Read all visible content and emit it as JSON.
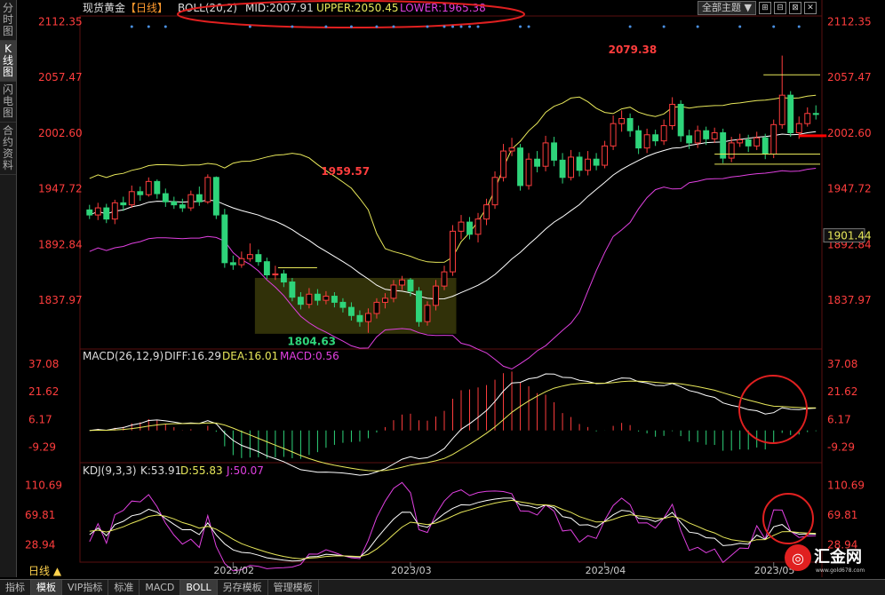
{
  "sidebar": {
    "items": [
      "分时图",
      "K线图",
      "闪电图",
      "合约资料"
    ],
    "active": 1
  },
  "top_controls": {
    "theme_select": "全部主题",
    "win_btns": [
      "⊞",
      "⊟",
      "⊠",
      "✕"
    ]
  },
  "bottom_bar": {
    "items": [
      "指标",
      "模板",
      "VIP指标",
      "标准",
      "MACD",
      "BOLL",
      "另存模板",
      "管理模板"
    ],
    "active": [
      1,
      5
    ]
  },
  "period_selector": "日线 ▲",
  "logo": {
    "text": "汇金网",
    "url": "www.gold678.com"
  },
  "colors": {
    "up": "#ff3d3d",
    "down": "#2ed47a",
    "up_fill": "#000000",
    "boll_mid": "#ffffff",
    "boll_upper": "#e8e85a",
    "boll_lower": "#e040e0",
    "diff": "#ffffff",
    "dea": "#e8e85a",
    "j": "#e040e0",
    "axis": "#ff3d3d"
  },
  "chart_data": [
    {
      "type": "candlestick",
      "title_parts": [
        "现货黄金",
        "【日线】"
      ],
      "indicator": {
        "name": "BOLL(20,2)",
        "mid_label": "MID:2007.91",
        "upper_label": "UPPER:2050.45",
        "lower_label": "LOWER:1965.38"
      },
      "yticks": [
        "2112.35",
        "2057.47",
        "2002.60",
        "1947.72",
        "1892.84",
        "1837.97"
      ],
      "ytick_values": [
        2112.35,
        2057.47,
        2002.6,
        1947.72,
        1892.84,
        1837.97
      ],
      "ylim": [
        1790,
        2118
      ],
      "current_price": "1901.44",
      "annotations": [
        {
          "text": "2079.38",
          "x": 61,
          "y": 2079.38
        },
        {
          "text": "1959.57",
          "x": 27,
          "y": 1959.57
        },
        {
          "text": "1804.63",
          "x": 23,
          "y": 1804.63
        }
      ],
      "candles": [
        [
          1927,
          1922,
          1932,
          1918
        ],
        [
          1922,
          1929,
          1934,
          1917
        ],
        [
          1929,
          1918,
          1933,
          1914
        ],
        [
          1918,
          1934,
          1937,
          1913
        ],
        [
          1934,
          1932,
          1940,
          1926
        ],
        [
          1932,
          1945,
          1951,
          1929
        ],
        [
          1945,
          1942,
          1950,
          1936
        ],
        [
          1942,
          1955,
          1959,
          1940
        ],
        [
          1955,
          1943,
          1957,
          1938
        ],
        [
          1943,
          1935,
          1948,
          1930
        ],
        [
          1935,
          1932,
          1940,
          1928
        ],
        [
          1932,
          1929,
          1938,
          1925
        ],
        [
          1929,
          1942,
          1946,
          1926
        ],
        [
          1942,
          1935,
          1950,
          1931
        ],
        [
          1935,
          1959,
          1962,
          1933
        ],
        [
          1959,
          1922,
          1960,
          1918
        ],
        [
          1922,
          1875,
          1928,
          1870
        ],
        [
          1875,
          1873,
          1882,
          1868
        ],
        [
          1873,
          1879,
          1886,
          1870
        ],
        [
          1879,
          1883,
          1894,
          1876
        ],
        [
          1883,
          1876,
          1888,
          1872
        ],
        [
          1876,
          1863,
          1880,
          1859
        ],
        [
          1863,
          1864,
          1872,
          1858
        ],
        [
          1864,
          1856,
          1868,
          1851
        ],
        [
          1856,
          1841,
          1860,
          1837
        ],
        [
          1841,
          1834,
          1846,
          1829
        ],
        [
          1834,
          1844,
          1850,
          1830
        ],
        [
          1844,
          1838,
          1849,
          1833
        ],
        [
          1838,
          1842,
          1847,
          1834
        ],
        [
          1842,
          1836,
          1846,
          1831
        ],
        [
          1836,
          1831,
          1840,
          1826
        ],
        [
          1831,
          1823,
          1836,
          1818
        ],
        [
          1823,
          1817,
          1828,
          1812
        ],
        [
          1817,
          1825,
          1830,
          1806
        ],
        [
          1825,
          1836,
          1840,
          1820
        ],
        [
          1836,
          1840,
          1845,
          1830
        ],
        [
          1840,
          1853,
          1858,
          1836
        ],
        [
          1853,
          1858,
          1862,
          1848
        ],
        [
          1858,
          1847,
          1860,
          1842
        ],
        [
          1847,
          1817,
          1851,
          1812
        ],
        [
          1817,
          1833,
          1837,
          1813
        ],
        [
          1833,
          1852,
          1858,
          1828
        ],
        [
          1852,
          1866,
          1872,
          1848
        ],
        [
          1866,
          1906,
          1912,
          1862
        ],
        [
          1906,
          1915,
          1922,
          1898
        ],
        [
          1915,
          1903,
          1920,
          1898
        ],
        [
          1903,
          1918,
          1924,
          1895
        ],
        [
          1918,
          1932,
          1938,
          1912
        ],
        [
          1932,
          1959,
          1965,
          1928
        ],
        [
          1959,
          1985,
          1992,
          1955
        ],
        [
          1985,
          1988,
          1998,
          1980
        ],
        [
          1988,
          1951,
          1992,
          1946
        ],
        [
          1951,
          1977,
          1983,
          1947
        ],
        [
          1977,
          1970,
          1985,
          1964
        ],
        [
          1970,
          1993,
          2000,
          1965
        ],
        [
          1993,
          1976,
          1999,
          1970
        ],
        [
          1976,
          1959,
          1983,
          1953
        ],
        [
          1959,
          1979,
          1986,
          1956
        ],
        [
          1979,
          1966,
          1984,
          1960
        ],
        [
          1966,
          1977,
          1985,
          1961
        ],
        [
          1977,
          1971,
          1983,
          1966
        ],
        [
          1971,
          1990,
          1995,
          1968
        ],
        [
          1990,
          2012,
          2020,
          1986
        ],
        [
          2012,
          2017,
          2025,
          2004
        ],
        [
          2017,
          2005,
          2022,
          1999
        ],
        [
          2005,
          1988,
          2010,
          1982
        ],
        [
          1988,
          2001,
          2007,
          1983
        ],
        [
          2001,
          1995,
          2006,
          1990
        ],
        [
          1995,
          2010,
          2016,
          1991
        ],
        [
          2010,
          2031,
          2038,
          2006
        ],
        [
          2031,
          2000,
          2035,
          1994
        ],
        [
          2000,
          1993,
          2006,
          1987
        ],
        [
          1993,
          2005,
          2010,
          1988
        ],
        [
          2005,
          1997,
          2009,
          1991
        ],
        [
          1997,
          2003,
          2008,
          1993
        ],
        [
          2003,
          1978,
          2007,
          1973
        ],
        [
          1978,
          1993,
          1999,
          1974
        ],
        [
          1993,
          1996,
          2002,
          1989
        ],
        [
          1996,
          1990,
          2001,
          1984
        ],
        [
          1990,
          1998,
          2004,
          1986
        ],
        [
          1998,
          1982,
          2002,
          1977
        ],
        [
          1982,
          2011,
          2016,
          1978
        ],
        [
          2011,
          2040,
          2079,
          2007
        ],
        [
          2040,
          2003,
          2044,
          1999
        ],
        [
          2003,
          2012,
          2019,
          1997
        ],
        [
          2012,
          2022,
          2028,
          2009
        ],
        [
          2022,
          2021,
          2030,
          2016
        ]
      ]
    },
    {
      "type": "macd",
      "label": "MACD(26,12,9)",
      "diff_label": "DIFF:16.29",
      "dea_label": "DEA:16.01",
      "macd_label": "MACD:0.56",
      "yticks": [
        "37.08",
        "21.62",
        "6.17",
        "-9.29"
      ],
      "ytick_values": [
        37.08,
        21.62,
        6.17,
        -9.29
      ],
      "ylim": [
        -18,
        44
      ]
    },
    {
      "type": "kdj",
      "label": "KDJ(9,3,3)",
      "k_label": "K:53.91",
      "d_label": "D:55.83",
      "j_label": "J:50.07",
      "yticks": [
        "110.69",
        "69.81",
        "28.94"
      ],
      "ytick_values": [
        110.69,
        69.81,
        28.94
      ],
      "ylim": [
        5,
        125
      ],
      "xticks": [
        "2023/02",
        "2023/03",
        "2023/04",
        "2023/05"
      ],
      "xtick_index": [
        17,
        38,
        61,
        81
      ]
    }
  ]
}
